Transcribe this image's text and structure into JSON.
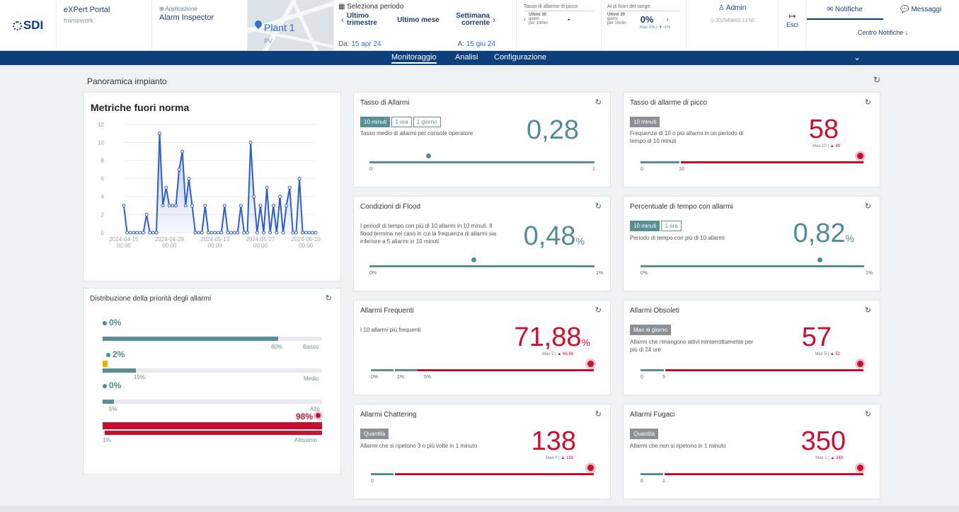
{
  "header": {
    "logo": "SDI",
    "portal_title": "eXPert Portal",
    "portal_sub": "framework",
    "app_label": "Applicazione",
    "app_name": "Alarm Inspector",
    "plant_name": "Plant 1",
    "plant_sub": "PV",
    "period_title": "Seleziona periodo",
    "period_options": [
      "Ultimo trimestre",
      "Ultimo mese",
      "Settimana corrente"
    ],
    "date_from_label": "Da:",
    "date_from": "15 apr 24",
    "date_to_label": "A:",
    "date_to": "15 giu 24",
    "kpi_peak": {
      "title": "Tasso di allarme di picco",
      "l1": "Ultimi 30",
      "l2": "giorni",
      "l3": "per 10min",
      "value": "-"
    },
    "kpi_range": {
      "title": "Al di fuori del range",
      "l1": "Ultimi 30",
      "l2": "giorni",
      "l3": "per 10min",
      "value": "0%",
      "sub": "max 1%",
      "delta": "-1%"
    },
    "admin": "Admin",
    "timestamp": "2025/09/03 13:50",
    "exit_label": "Esci",
    "tab_notifications": "Notifiche",
    "tab_messages": "Messaggi",
    "center_notifications": "Centro Notifiche"
  },
  "nav": {
    "items": [
      "Monitoraggio",
      "Analisi",
      "Configurazione"
    ]
  },
  "overview_title": "Panoramica impianto",
  "chart_card": {
    "title": "Metriche fuori norma"
  },
  "chart_data": {
    "type": "line",
    "ylim": [
      0,
      12
    ],
    "yticks": [
      0,
      2,
      4,
      6,
      8,
      10,
      12
    ],
    "xticks": [
      "2024-04-15 00:00",
      "2024-04-29 00:00",
      "2024-05-13 00:00",
      "2024-05-27 00:00",
      "2024-06-10 00:00"
    ],
    "xtick_index": [
      0,
      14,
      28,
      42,
      56
    ],
    "values": [
      3,
      0,
      0,
      0,
      0,
      0,
      0,
      2,
      0,
      0,
      0,
      11,
      3,
      5,
      3,
      3,
      3,
      7,
      9,
      3,
      6,
      3,
      0,
      0,
      0,
      3,
      0,
      0,
      0,
      0,
      0,
      3,
      0,
      0,
      0,
      0,
      3,
      0,
      0,
      10,
      4,
      0,
      3,
      0,
      5,
      0,
      3,
      0,
      4,
      0,
      3,
      5,
      0,
      0,
      6,
      0,
      0,
      0,
      0,
      0
    ]
  },
  "distribution": {
    "title": "Distribuzione della priorità degli allarmi",
    "rows": [
      {
        "pct": "0%",
        "fill": 80,
        "fill_label": "80%",
        "name": "Basso",
        "color": "#5a8f96"
      },
      {
        "pct": "2%",
        "fill": 15,
        "fill_label": "15%",
        "name": "Medio",
        "color": "#5a8f96"
      },
      {
        "pct": "0%",
        "fill": 5,
        "fill_label": "5%",
        "name": "Alto",
        "color": "#5a8f96"
      },
      {
        "pct": "98%",
        "fill": 100,
        "fill_label": "1%",
        "name": "Altissimo",
        "color": "#c8102e"
      }
    ]
  },
  "cards": {
    "tasso": {
      "title": "Tasso di Allarmi",
      "pills": [
        "10 minuti",
        "1 ora",
        "1 giorno"
      ],
      "desc": "Tasso medio di allarmi per console operatore",
      "value": "0,28",
      "min": "0",
      "max": "1"
    },
    "picco": {
      "title": "Tasso di allarme di picco",
      "pill": "10 minuti",
      "desc": "Frequenza di 10 o più allarmi in un periodo di tempo di 10 minuti",
      "value": "58",
      "max_label": "Max 10",
      "delta": "48",
      "l0": "0",
      "l1": "10"
    },
    "flood": {
      "title": "Condizioni di Flood",
      "desc": "I periodi di tempo con più di 10 allarmi in 10 minuti. Il flood termina nel caso in cui la frequenza di allarmi sia inferiore a 5 allarmi in 10 minuti",
      "value": "0,48",
      "unit": "%",
      "min": "0%",
      "max": "1%"
    },
    "perc": {
      "title": "Percentuale di tempo con allarmi",
      "pills": [
        "10 minuti",
        "1 ora"
      ],
      "desc": "Periodo di tempo con più di 10 allarmi",
      "value": "0,82",
      "unit": "%",
      "min": "0%",
      "max": "1%"
    },
    "frequenti": {
      "title": "Allarmi Frequenti",
      "desc": "I 10 allarmi più frequenti",
      "value": "71,88",
      "unit": "%",
      "max_label": "Max 5",
      "delta": "66,88",
      "l0": "0%",
      "l1": "1%",
      "l2": "5%"
    },
    "obsoleti": {
      "title": "Allarmi Obsoleti",
      "pill": "Max al giorno",
      "desc": "Allarmi che rimangono attivi ininterrottamente per più di 24 ore",
      "value": "57",
      "max_label": "Max 5",
      "delta": "52",
      "l0": "0",
      "l1": "5"
    },
    "chattering": {
      "title": "Allarmi Chattering",
      "pill": "Quantità",
      "desc": "Allarmi che si ripetono 3 o più volte in 1 minuto",
      "value": "138",
      "max_label": "Max 0",
      "delta": "138",
      "l0": "0"
    },
    "fugaci": {
      "title": "Allarmi Fugaci",
      "pill": "Quantità",
      "desc": "Allarmi che non si ripetono in 1 minuto",
      "value": "350",
      "max_label": "Max 1",
      "delta": "349",
      "l0": "0",
      "l1": "1"
    }
  }
}
